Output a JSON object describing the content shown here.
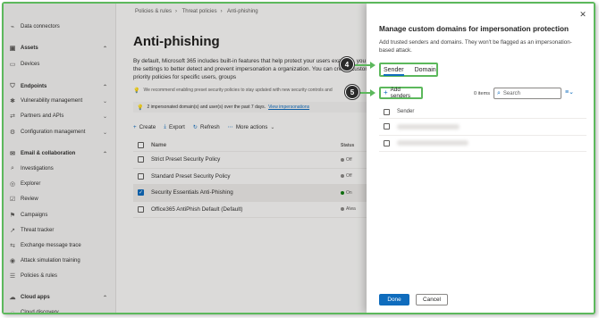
{
  "sidebar": {
    "items": [
      {
        "label": "Data connectors",
        "icon": "plug-icon",
        "type": "sub"
      },
      {
        "label": "Assets",
        "icon": "box-icon",
        "type": "head",
        "chevron": "chevron-up-icon"
      },
      {
        "label": "Devices",
        "icon": "laptop-icon",
        "type": "sub"
      },
      {
        "label": "Endpoints",
        "icon": "shield-icon",
        "type": "head",
        "chevron": "chevron-up-icon"
      },
      {
        "label": "Vulnerability management",
        "icon": "bug-icon",
        "type": "sub",
        "chevron": "chevron-down-icon"
      },
      {
        "label": "Partners and APIs",
        "icon": "api-icon",
        "type": "sub",
        "chevron": "chevron-down-icon"
      },
      {
        "label": "Configuration management",
        "icon": "settings-icon",
        "type": "sub",
        "chevron": "chevron-down-icon"
      },
      {
        "label": "Email & collaboration",
        "icon": "mail-icon",
        "type": "head",
        "chevron": "chevron-up-icon"
      },
      {
        "label": "Investigations",
        "icon": "investigate-icon",
        "type": "sub"
      },
      {
        "label": "Explorer",
        "icon": "explorer-icon",
        "type": "sub"
      },
      {
        "label": "Review",
        "icon": "review-icon",
        "type": "sub"
      },
      {
        "label": "Campaigns",
        "icon": "campaign-icon",
        "type": "sub"
      },
      {
        "label": "Threat tracker",
        "icon": "tracker-icon",
        "type": "sub"
      },
      {
        "label": "Exchange message trace",
        "icon": "trace-icon",
        "type": "sub"
      },
      {
        "label": "Attack simulation training",
        "icon": "target-icon",
        "type": "sub"
      },
      {
        "label": "Policies & rules",
        "icon": "policy-icon",
        "type": "sub"
      },
      {
        "label": "Cloud apps",
        "icon": "cloud-icon",
        "type": "head",
        "chevron": "chevron-up-icon"
      },
      {
        "label": "Cloud discovery",
        "icon": "discovery-icon",
        "type": "sub"
      }
    ]
  },
  "breadcrumb": [
    "Policies & rules",
    "Threat policies",
    "Anti-phishing"
  ],
  "page": {
    "title": "Anti-phishing",
    "description": "By default, Microsoft 365 includes built-in features that help protect your users example, you can refining the settings to better detect and prevent impersonation a organization. You can create custom, higher priority policies for specific users, groups",
    "recommend_banner": "We recommend enabling preset security policies to stay updated with new security controls and",
    "impersonation_banner": "2 impersonated domain(s) and user(s) over the past 7 days.",
    "impersonation_link": "View impersonations"
  },
  "toolbar": {
    "create": "Create",
    "export": "Export",
    "refresh": "Refresh",
    "more": "More actions"
  },
  "table": {
    "header_name": "Name",
    "header_status": "Status",
    "rows": [
      {
        "name": "Strict Preset Security Policy",
        "status": "Off",
        "selected": false
      },
      {
        "name": "Standard Preset Security Policy",
        "status": "Off",
        "selected": false
      },
      {
        "name": "Security Essentials Anti-Phishing",
        "status": "On",
        "selected": true
      },
      {
        "name": "Office365 AntiPhish Default (Default)",
        "status": "Alwa",
        "selected": false
      }
    ]
  },
  "panel": {
    "title": "Manage custom domains for impersonation protection",
    "description": "Add trusted senders and domains. They won't be flagged as an impersonation-based attack.",
    "tabs": [
      "Sender",
      "Domain"
    ],
    "active_tab": "Sender",
    "add_button": "Add senders",
    "items_count": "0 items",
    "search_placeholder": "Search",
    "list_header": "Sender",
    "done_button": "Done",
    "cancel_button": "Cancel"
  },
  "callouts": {
    "tabs": "4",
    "add": "5"
  },
  "colors": {
    "accent": "#0f6cbd",
    "highlight": "#5cb85c",
    "callout": "#2b2b2b"
  }
}
